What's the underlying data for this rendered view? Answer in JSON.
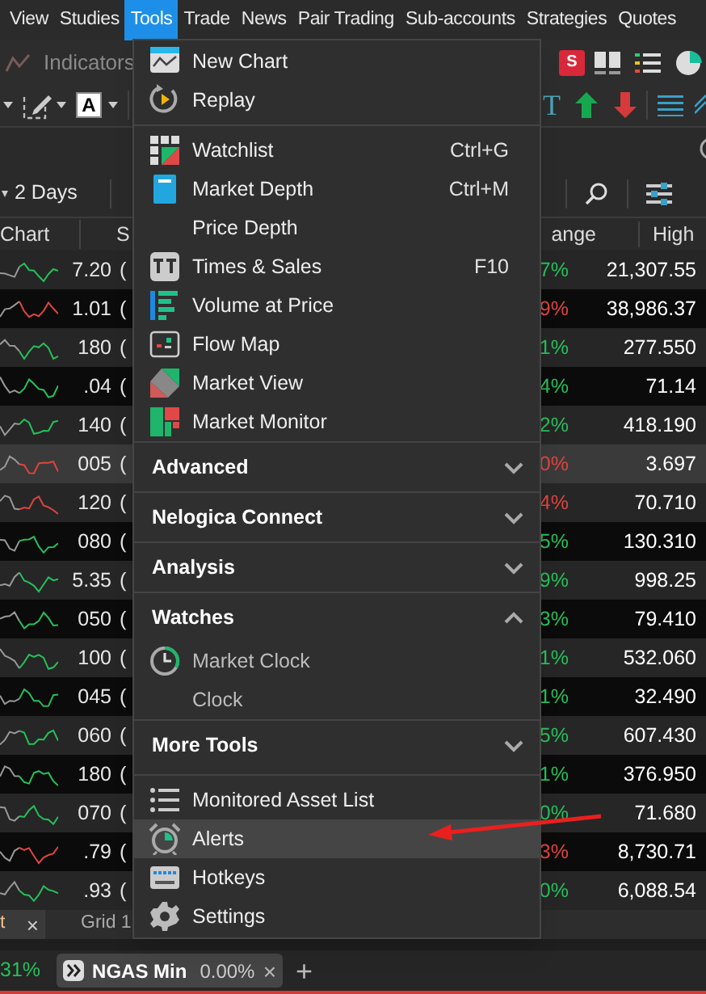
{
  "menubar": [
    {
      "label": "View",
      "selected": false
    },
    {
      "label": "Studies",
      "selected": false
    },
    {
      "label": "Tools",
      "selected": true
    },
    {
      "label": "Trade",
      "selected": false
    },
    {
      "label": "News",
      "selected": false
    },
    {
      "label": "Pair Trading",
      "selected": false
    },
    {
      "label": "Sub-accounts",
      "selected": false
    },
    {
      "label": "Strategies",
      "selected": false
    },
    {
      "label": "Quotes",
      "selected": false
    }
  ],
  "toolbar": {
    "indicators": "Indicators",
    "strategy_badge": "S",
    "text_color_label": "A",
    "text_tool": "T",
    "period": "2 Days"
  },
  "table": {
    "columns": [
      "Chart",
      "S",
      "ange",
      "High"
    ],
    "rows": [
      {
        "value": "7.20",
        "bracket": "(",
        "change": "7%",
        "color": "#25c05a",
        "high": "21,307.55",
        "selected": false
      },
      {
        "value": "1.01",
        "bracket": "(",
        "change": "9%",
        "color": "#e0443e",
        "high": "38,986.37",
        "selected": false
      },
      {
        "value": "180",
        "bracket": "(",
        "change": "1%",
        "color": "#25c05a",
        "high": "277.550",
        "selected": false
      },
      {
        "value": ".04",
        "bracket": "(",
        "change": "4%",
        "color": "#25c05a",
        "high": "71.14",
        "selected": false
      },
      {
        "value": "140",
        "bracket": "(",
        "change": "2%",
        "color": "#25c05a",
        "high": "418.190",
        "selected": false
      },
      {
        "value": "005",
        "bracket": "(",
        "change": "0%",
        "color": "#e0443e",
        "high": "3.697",
        "selected": true
      },
      {
        "value": "120",
        "bracket": "(",
        "change": "4%",
        "color": "#e0443e",
        "high": "70.710",
        "selected": false
      },
      {
        "value": "080",
        "bracket": "(",
        "change": "5%",
        "color": "#25c05a",
        "high": "130.310",
        "selected": false
      },
      {
        "value": "5.35",
        "bracket": "(",
        "change": "9%",
        "color": "#25c05a",
        "high": "998.25",
        "selected": false
      },
      {
        "value": "050",
        "bracket": "(",
        "change": "3%",
        "color": "#25c05a",
        "high": "79.410",
        "selected": false
      },
      {
        "value": "100",
        "bracket": "(",
        "change": "1%",
        "color": "#25c05a",
        "high": "532.060",
        "selected": false
      },
      {
        "value": "045",
        "bracket": "(",
        "change": "1%",
        "color": "#25c05a",
        "high": "32.490",
        "selected": false
      },
      {
        "value": "060",
        "bracket": "(",
        "change": "5%",
        "color": "#25c05a",
        "high": "607.430",
        "selected": false
      },
      {
        "value": "180",
        "bracket": "(",
        "change": "1%",
        "color": "#25c05a",
        "high": "376.950",
        "selected": false
      },
      {
        "value": "070",
        "bracket": "(",
        "change": "0%",
        "color": "#25c05a",
        "high": "71.680",
        "selected": false
      },
      {
        "value": ".79",
        "bracket": "(",
        "change": "3%",
        "color": "#e0443e",
        "high": "8,730.71",
        "selected": false
      },
      {
        "value": ".93",
        "bracket": "(",
        "change": "0%",
        "color": "#25c05a",
        "high": "6,088.54",
        "selected": false
      }
    ]
  },
  "bottom_tabs": [
    {
      "label": "t",
      "close": "×",
      "selected": true
    },
    {
      "label": "Grid 1",
      "selected": false
    }
  ],
  "status_bar": {
    "change": "31%",
    "tab": {
      "label": "NGAS Min",
      "change": "0.00%",
      "close": "×"
    },
    "add": "+"
  },
  "tools_menu": [
    {
      "kind": "item",
      "label": "New Chart"
    },
    {
      "kind": "item",
      "label": "Replay"
    },
    {
      "kind": "separator"
    },
    {
      "kind": "item",
      "label": "Watchlist",
      "shortcut": "Ctrl+G"
    },
    {
      "kind": "item",
      "label": "Market Depth",
      "shortcut": "Ctrl+M"
    },
    {
      "kind": "item",
      "label": "Price Depth"
    },
    {
      "kind": "item",
      "label": "Times & Sales",
      "shortcut": "F10"
    },
    {
      "kind": "item",
      "label": "Volume at Price"
    },
    {
      "kind": "item",
      "label": "Flow Map"
    },
    {
      "kind": "item",
      "label": "Market View"
    },
    {
      "kind": "item",
      "label": "Market Monitor"
    },
    {
      "kind": "section",
      "label": "Advanced",
      "expanded": false
    },
    {
      "kind": "section",
      "label": "Nelogica Connect",
      "expanded": false
    },
    {
      "kind": "section",
      "label": "Analysis",
      "expanded": false
    },
    {
      "kind": "section",
      "label": "Watches",
      "expanded": true
    },
    {
      "kind": "subitem",
      "label": "Market Clock"
    },
    {
      "kind": "subitem",
      "label": "Clock"
    },
    {
      "kind": "section",
      "label": "More Tools",
      "expanded": false
    },
    {
      "kind": "separator"
    },
    {
      "kind": "item",
      "label": "Monitored Asset List"
    },
    {
      "kind": "item",
      "label": "Alerts",
      "selected": true
    },
    {
      "kind": "item",
      "label": "Hotkeys"
    },
    {
      "kind": "item",
      "label": "Settings"
    }
  ]
}
